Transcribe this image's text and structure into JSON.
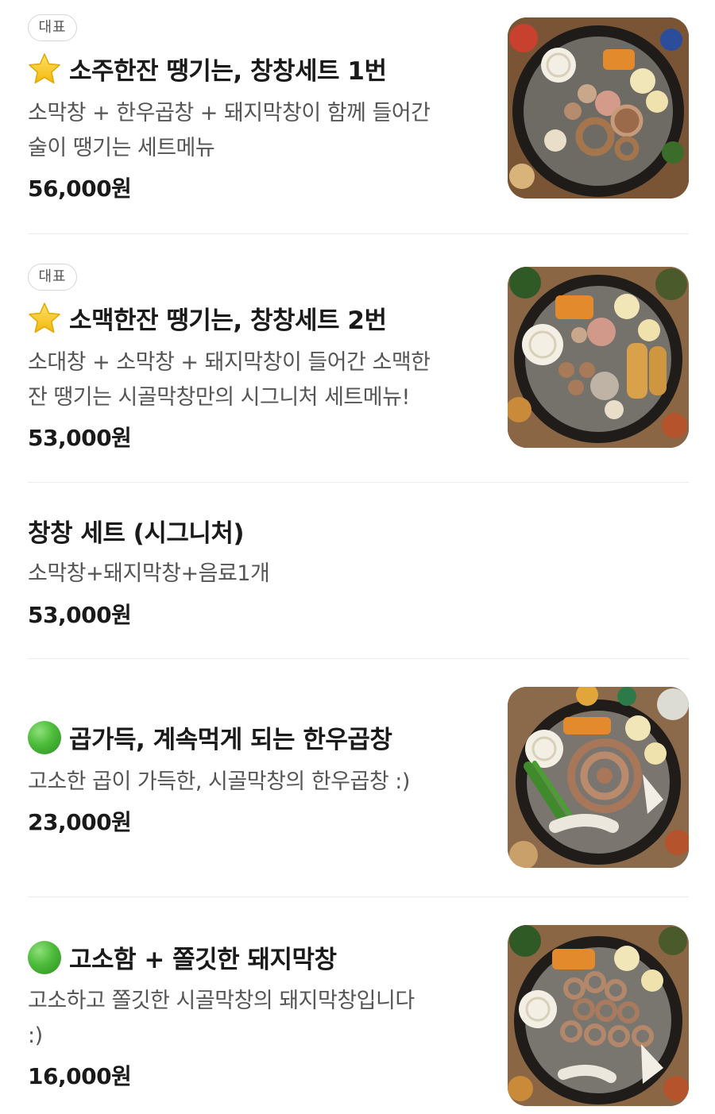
{
  "menu": {
    "items": [
      {
        "badge": "대표",
        "icon": "star-icon",
        "title": "소주한잔 땡기는, 창창세트 1번",
        "description_lines": [
          "소막창 + 한우곱창 + 돼지막창이 함께 들어간",
          "술이 땡기는 세트메뉴"
        ],
        "price": "56,000원",
        "has_photo": true
      },
      {
        "badge": "대표",
        "icon": "star-icon",
        "title": "소맥한잔 땡기는, 창창세트 2번",
        "description_lines": [
          "소대창 + 소막창 + 돼지막창이 들어간 소맥한",
          "잔 땡기는 시골막창만의 시그니처 세트메뉴!"
        ],
        "price": "53,000원",
        "has_photo": true
      },
      {
        "badge": "",
        "icon": "",
        "title": "창창 세트 (시그니처)",
        "description_lines": [
          "소막창+돼지막창+음료1개"
        ],
        "price": "53,000원",
        "has_photo": false
      },
      {
        "badge": "",
        "icon": "green-circle-icon",
        "title": "곱가득, 계속먹게 되는 한우곱창",
        "description_lines": [
          "고소한 곱이 가득한, 시골막창의 한우곱창 :)"
        ],
        "price": "23,000원",
        "has_photo": true
      },
      {
        "badge": "",
        "icon": "green-circle-icon",
        "title": "고소함 + 쫄깃한 돼지막창",
        "description_lines": [
          "고소하고 쫄깃한 시골막창의 돼지막창입니다",
          ":)"
        ],
        "price": "16,000원",
        "has_photo": true
      }
    ]
  },
  "colors": {
    "title": "#1a1a1a",
    "description": "#555555",
    "divider": "#ececec",
    "badge_border": "#d6d6d6",
    "star": "#f5c518",
    "green_circle": "#4cbb3a"
  }
}
